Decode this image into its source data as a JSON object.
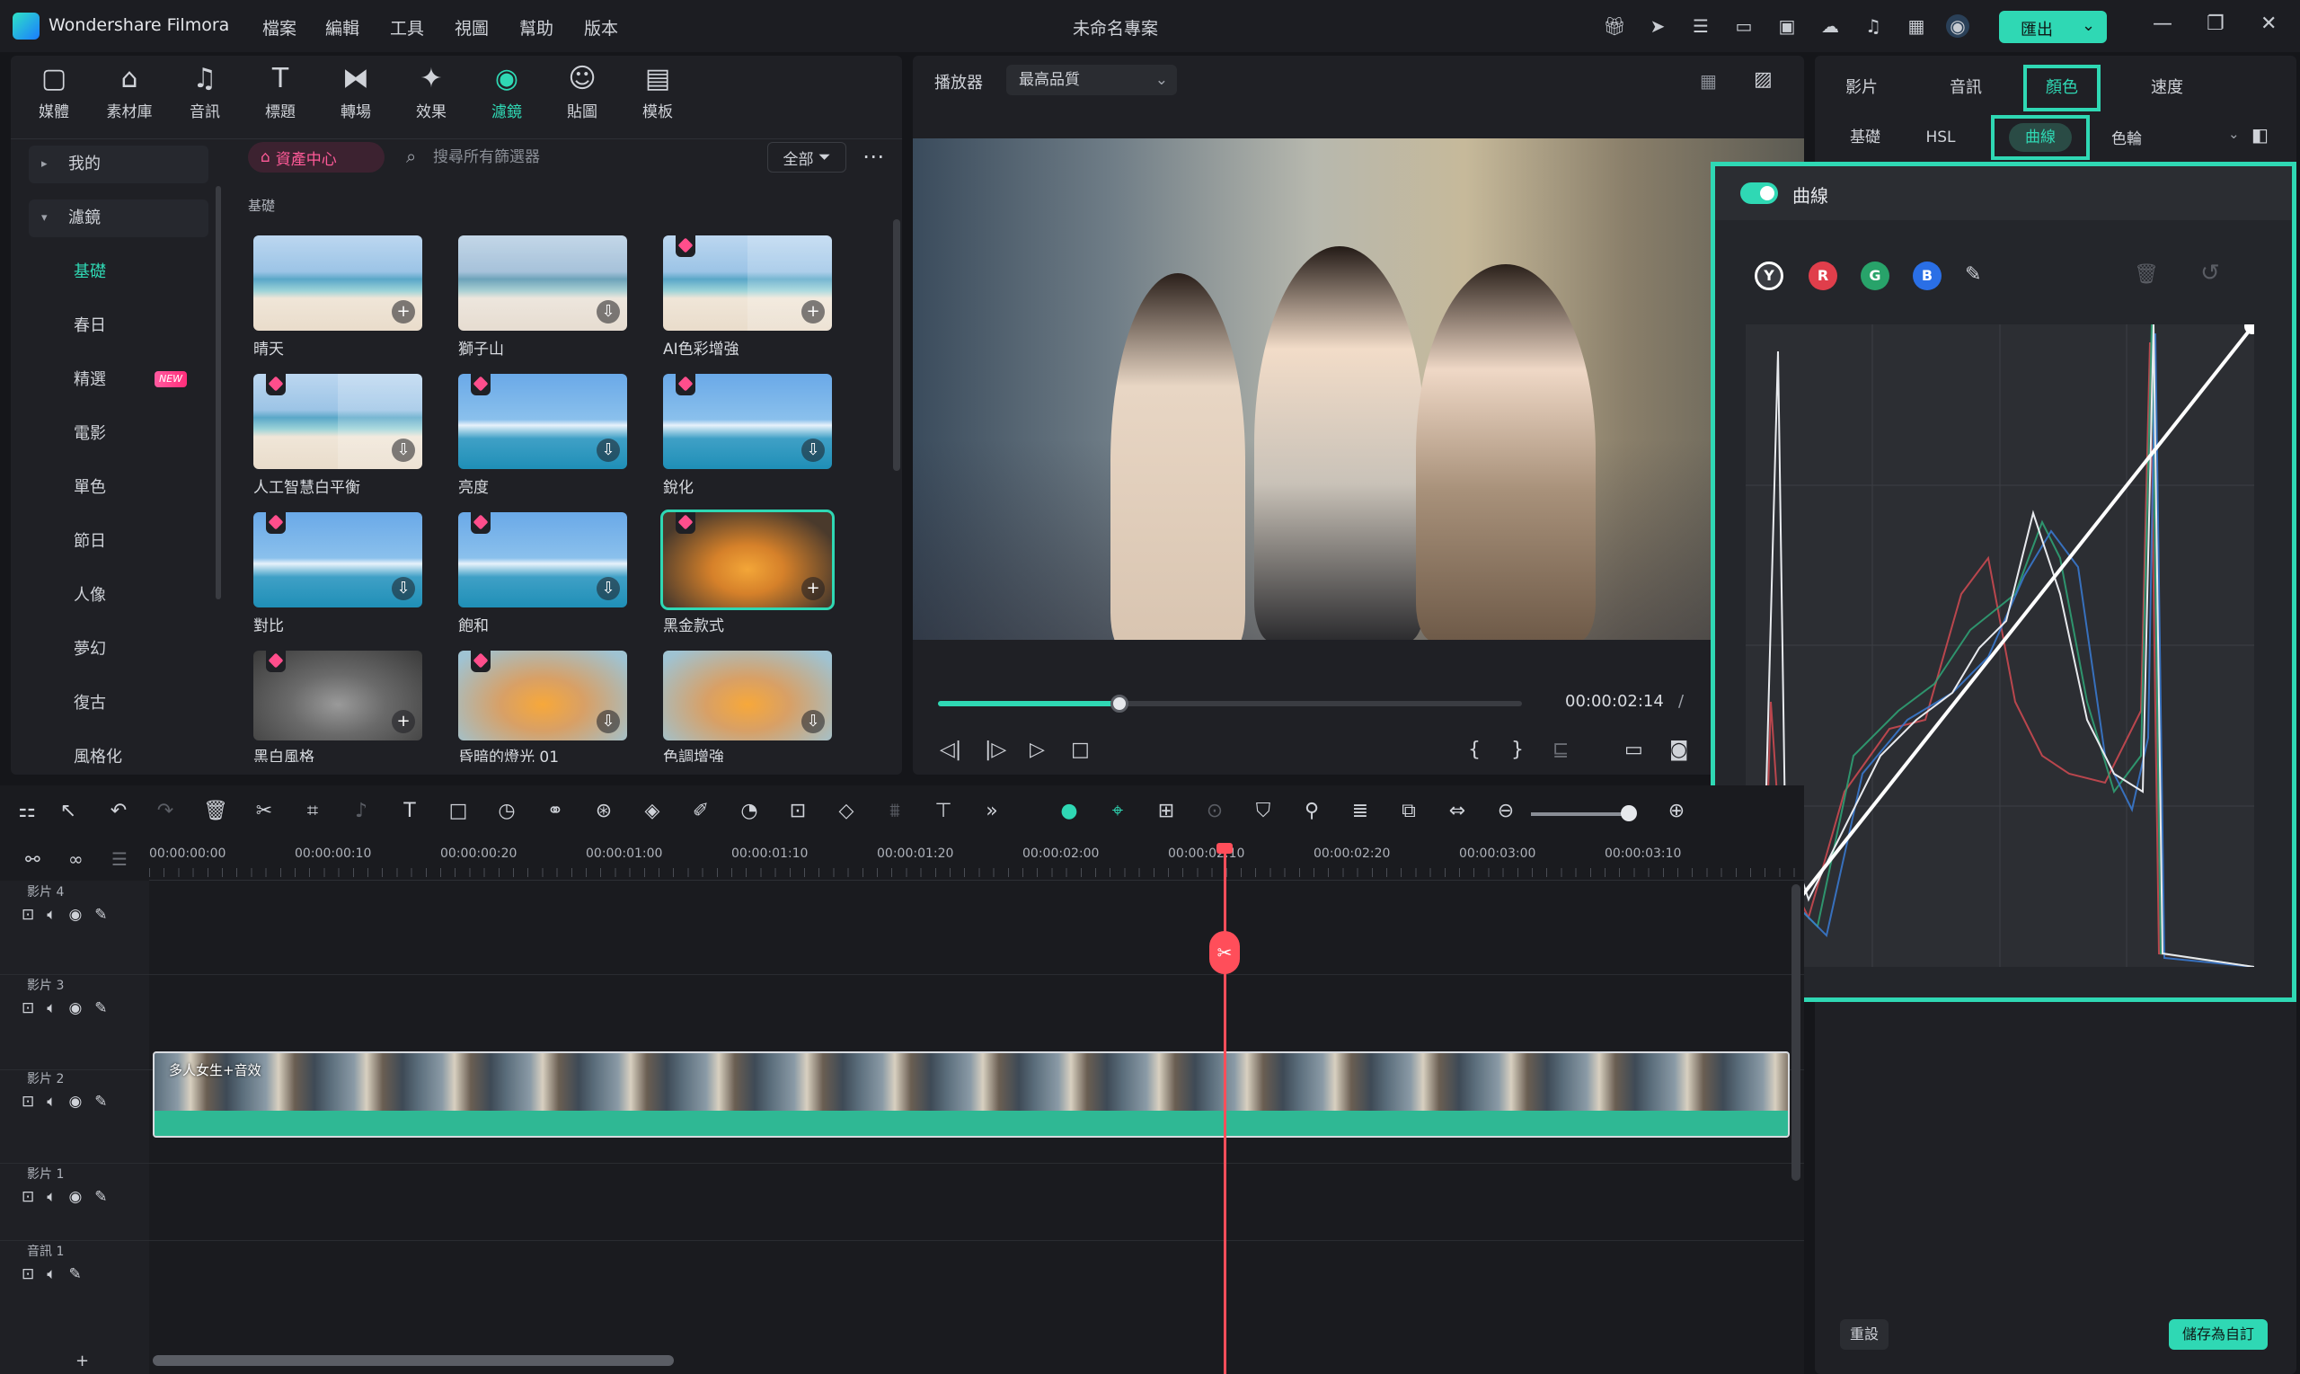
{
  "app": {
    "name": "Wondershare Filmora",
    "project_title": "未命名專案"
  },
  "menu": [
    "檔案",
    "編輯",
    "工具",
    "視圖",
    "幫助",
    "版本"
  ],
  "export": {
    "label": "匯出"
  },
  "tool_tabs": [
    {
      "label": "媒體",
      "icon": "media-icon"
    },
    {
      "label": "素材庫",
      "icon": "stock-icon"
    },
    {
      "label": "音訊",
      "icon": "music-icon"
    },
    {
      "label": "標題",
      "icon": "title-icon"
    },
    {
      "label": "轉場",
      "icon": "transition-icon"
    },
    {
      "label": "效果",
      "icon": "effects-icon"
    },
    {
      "label": "濾鏡",
      "icon": "filter-icon"
    },
    {
      "label": "貼圖",
      "icon": "sticker-icon"
    },
    {
      "label": "模板",
      "icon": "template-icon"
    }
  ],
  "sidebar": {
    "groups": [
      {
        "label": "我的"
      },
      {
        "label": "濾鏡"
      }
    ],
    "items": [
      "基礎",
      "春日",
      "精選",
      "電影",
      "單色",
      "節日",
      "人像",
      "夢幻",
      "復古",
      "風格化"
    ],
    "new_badge": "NEW"
  },
  "library": {
    "asset_center": "資產中心",
    "search_placeholder": "搜尋所有篩選器",
    "filter_label": "全部",
    "section": "基礎",
    "filters": [
      {
        "label": "晴天"
      },
      {
        "label": "獅子山"
      },
      {
        "label": "AI色彩增強"
      },
      {
        "label": "人工智慧白平衡"
      },
      {
        "label": "亮度"
      },
      {
        "label": "銳化"
      },
      {
        "label": "對比"
      },
      {
        "label": "飽和"
      },
      {
        "label": "黑金款式"
      },
      {
        "label": "黑白風格"
      },
      {
        "label": "昏暗的燈光 01"
      },
      {
        "label": "色調增強"
      }
    ]
  },
  "player": {
    "label": "播放器",
    "quality": "最高品質",
    "timecode": "00:00:02:14",
    "separator": "/",
    "progress": 0.31
  },
  "right_panel": {
    "tabs": [
      "影片",
      "音訊",
      "顏色",
      "速度"
    ],
    "subtabs": [
      "基礎",
      "HSL",
      "曲線"
    ],
    "wheel_select": "色輪",
    "curve_title": "曲線",
    "channels": [
      "Y",
      "R",
      "G",
      "B"
    ],
    "reset": "重設",
    "save": "儲存為自訂"
  },
  "timeline": {
    "ruler": [
      "00:00:00:00",
      "00:00:00:10",
      "00:00:00:20",
      "00:00:01:00",
      "00:00:01:10",
      "00:00:01:20",
      "00:00:02:00",
      "00:00:02:10",
      "00:00:02:20",
      "00:00:03:00",
      "00:00:03:10"
    ],
    "tracks": [
      "影片 4",
      "影片 3",
      "影片 2",
      "影片 1",
      "音訊 1"
    ],
    "clip_title": "多人女生+音效",
    "add_track": "+"
  },
  "colors": {
    "accent": "#2fd8b4",
    "playhead": "#ff4e5a",
    "premium": "#ff4e8c"
  }
}
